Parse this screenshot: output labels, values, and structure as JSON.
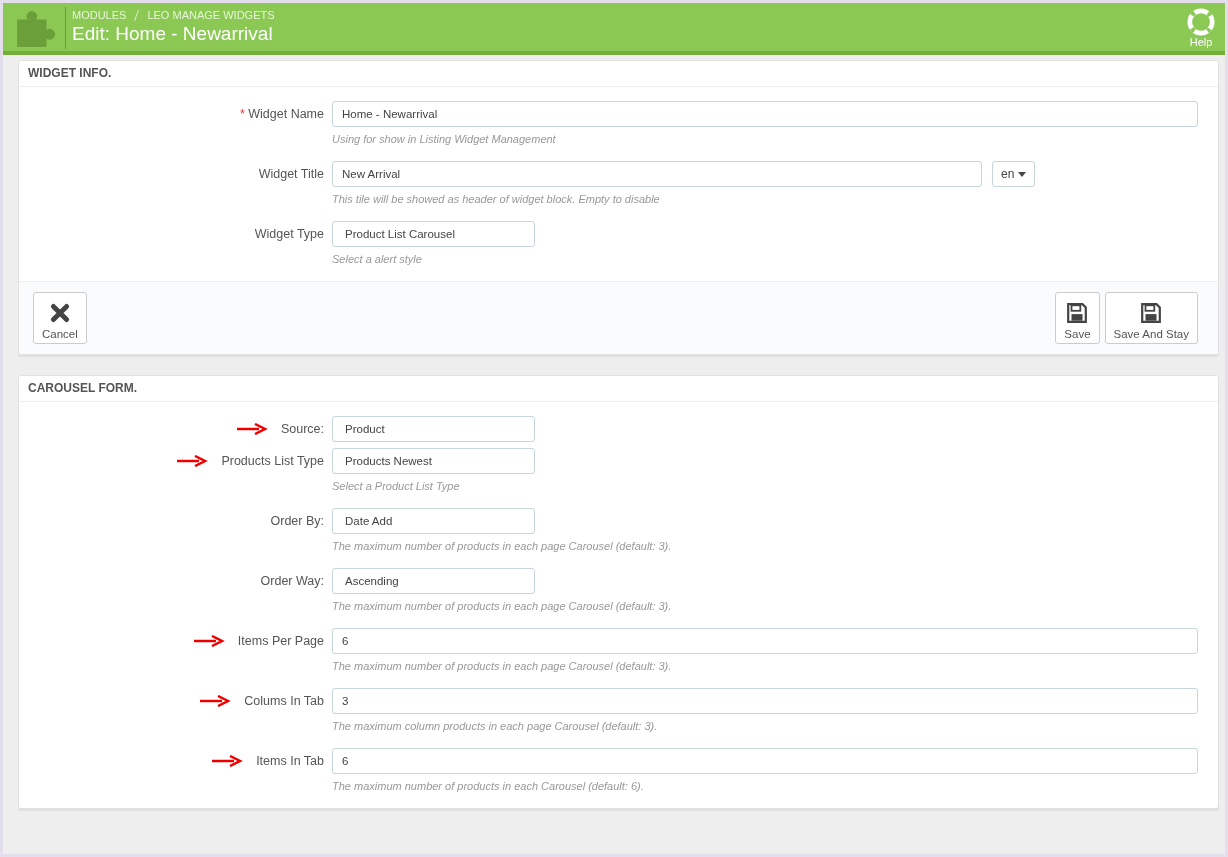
{
  "header": {
    "breadcrumb": [
      "MODULES",
      "LEO MANAGE WIDGETS"
    ],
    "title": "Edit: Home - Newarrival",
    "help_label": "Help"
  },
  "widget_info": {
    "heading": "WIDGET INFO.",
    "rows": [
      {
        "kind": "full",
        "label": "Widget Name",
        "required_mark": "*",
        "marked": false,
        "value": "Home - Newarrival",
        "help": "Using for show in Listing Widget Management"
      },
      {
        "kind": "lang",
        "label": "Widget Title",
        "marked": false,
        "value": "New Arrival",
        "lang": "en",
        "help": "This tile will be showed as header of widget block. Empty to disable"
      },
      {
        "kind": "short",
        "label": "Widget Type",
        "marked": false,
        "value": "Product List Carousel",
        "help": "Select a alert style"
      }
    ],
    "buttons": [
      {
        "kind": "cancel",
        "label": "Cancel"
      },
      {
        "kind": "save",
        "label": "Save"
      },
      {
        "kind": "save",
        "label": "Save And Stay"
      }
    ]
  },
  "carousel_form": {
    "heading": "CAROUSEL FORM.",
    "rows": [
      {
        "kind": "short",
        "label": "Source:",
        "marked": true,
        "value": "Product"
      },
      {
        "kind": "short",
        "label": "Products List Type",
        "marked": true,
        "value": "Products Newest",
        "help": "Select a Product List Type"
      },
      {
        "kind": "short",
        "label": "Order By:",
        "marked": false,
        "value": "Date Add",
        "help": "The maximum number of products in each page Carousel (default: 3)."
      },
      {
        "kind": "short",
        "label": "Order Way:",
        "marked": false,
        "value": "Ascending",
        "help": "The maximum number of products in each page Carousel (default: 3)."
      },
      {
        "kind": "full",
        "label": "Items Per Page",
        "marked": true,
        "value": "6",
        "help": "The maximum number of products in each page Carousel (default: 3)."
      },
      {
        "kind": "full",
        "label": "Colums In Tab",
        "marked": true,
        "value": "3",
        "help": "The maximum column products in each page Carousel (default: 3)."
      },
      {
        "kind": "full",
        "label": "Items In Tab",
        "marked": true,
        "value": "6",
        "help": "The maximum number of products in each Carousel (default: 6)."
      }
    ]
  }
}
